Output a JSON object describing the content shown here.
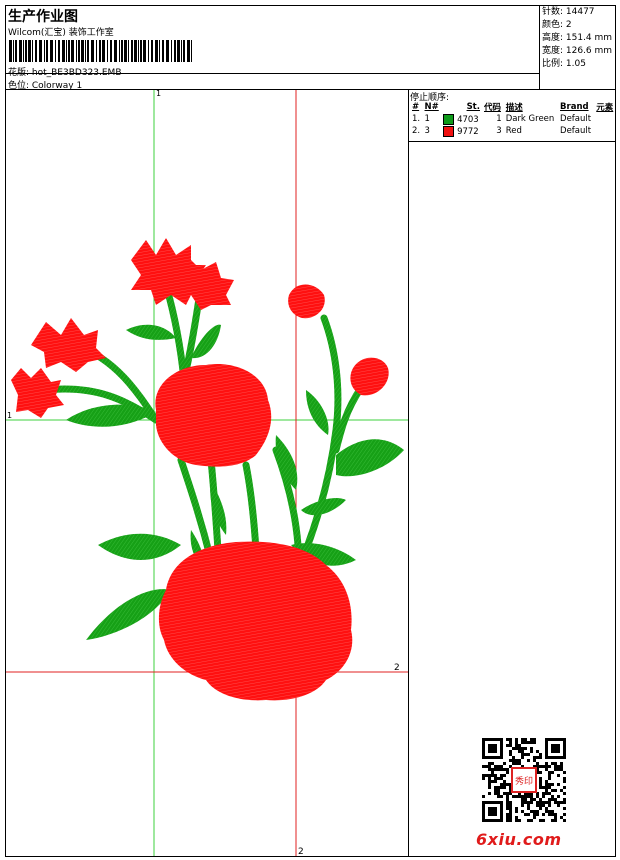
{
  "header": {
    "title": "生产作业图",
    "subtitle": "Wilcom(汇宝) 装饰工作室",
    "pattern_label": "花版: hot_BE3BD323.EMB",
    "colorway_label": "色位: Colorway 1"
  },
  "stats": {
    "stitches": "针数: 14477",
    "colors": "颜色: 2",
    "height": "高度: 151.4 mm",
    "width": "宽度: 126.6 mm",
    "scale": "比例: 1.05"
  },
  "stop_sequence": {
    "title": "停止顺序:",
    "headers": [
      "#",
      "N#",
      "St.",
      "代码",
      "描述",
      "Brand",
      "元素"
    ],
    "rows": [
      {
        "idx": "1.",
        "n": "1",
        "st": "4703",
        "code": "1",
        "desc": "Dark Green",
        "brand": "Default",
        "color": "#0e9a1a"
      },
      {
        "idx": "2.",
        "n": "3",
        "st": "9772",
        "code": "3",
        "desc": "Red",
        "brand": "Default",
        "color": "#f01010"
      }
    ]
  },
  "guides": {
    "green_top": "1",
    "green_left": "1",
    "red_right": "2",
    "red_bottom": "2"
  },
  "colors": {
    "green": "#16a016",
    "red": "#ff1010",
    "guide_green": "#3ed03e",
    "guide_red": "#e02020"
  },
  "watermark": {
    "brand": "6xiu.com",
    "seal": "秀印"
  }
}
